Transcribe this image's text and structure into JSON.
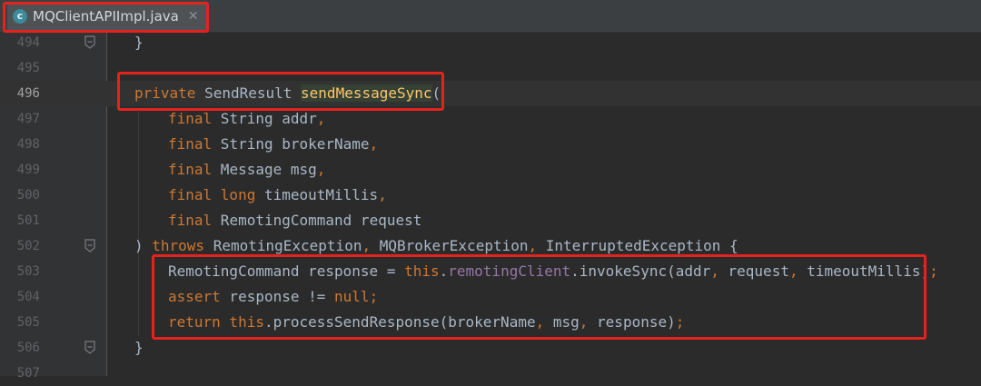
{
  "tab": {
    "icon_letter": "c",
    "label": "MQClientAPIImpl.java",
    "close": "✕",
    "active": true
  },
  "colors": {
    "background": "#2b2b2b",
    "keyword": "#cc7832",
    "method": "#ffc66d",
    "field": "#9876aa",
    "text": "#a9b7c6",
    "annotation_box": "#e3231e"
  },
  "lines": [
    {
      "num": "494",
      "indent": 0,
      "tokens": [
        {
          "t": "}",
          "c": ""
        }
      ],
      "fold": true
    },
    {
      "num": "495",
      "indent": 0,
      "tokens": []
    },
    {
      "num": "496",
      "indent": 0,
      "current": true,
      "tokens": [
        {
          "t": "private",
          "c": "kw"
        },
        {
          "t": " SendResult ",
          "c": ""
        },
        {
          "t": "sendMessageSync",
          "c": "fn"
        },
        {
          "t": "(",
          "c": ""
        }
      ]
    },
    {
      "num": "497",
      "indent": 1,
      "tokens": [
        {
          "t": "final",
          "c": "kw"
        },
        {
          "t": " String addr",
          "c": ""
        },
        {
          "t": ",",
          "c": "kw"
        }
      ]
    },
    {
      "num": "498",
      "indent": 1,
      "tokens": [
        {
          "t": "final",
          "c": "kw"
        },
        {
          "t": " String brokerName",
          "c": ""
        },
        {
          "t": ",",
          "c": "kw"
        }
      ]
    },
    {
      "num": "499",
      "indent": 1,
      "tokens": [
        {
          "t": "final",
          "c": "kw"
        },
        {
          "t": " Message msg",
          "c": ""
        },
        {
          "t": ",",
          "c": "kw"
        }
      ]
    },
    {
      "num": "500",
      "indent": 1,
      "tokens": [
        {
          "t": "final long",
          "c": "kw"
        },
        {
          "t": " timeoutMillis",
          "c": ""
        },
        {
          "t": ",",
          "c": "kw"
        }
      ]
    },
    {
      "num": "501",
      "indent": 1,
      "tokens": [
        {
          "t": "final",
          "c": "kw"
        },
        {
          "t": " RemotingCommand request",
          "c": ""
        }
      ]
    },
    {
      "num": "502",
      "indent": 0,
      "fold": true,
      "tokens": [
        {
          "t": ") ",
          "c": ""
        },
        {
          "t": "throws",
          "c": "kw"
        },
        {
          "t": " RemotingException",
          "c": ""
        },
        {
          "t": ",",
          "c": "kw"
        },
        {
          "t": " MQBrokerException",
          "c": ""
        },
        {
          "t": ",",
          "c": "kw"
        },
        {
          "t": " InterruptedException {",
          "c": ""
        }
      ]
    },
    {
      "num": "503",
      "indent": 1,
      "tokens": [
        {
          "t": "RemotingCommand response = ",
          "c": ""
        },
        {
          "t": "this",
          "c": "kw"
        },
        {
          "t": ".",
          "c": ""
        },
        {
          "t": "remotingClient",
          "c": "fld"
        },
        {
          "t": ".invokeSync(addr",
          "c": ""
        },
        {
          "t": ",",
          "c": "kw"
        },
        {
          "t": " request",
          "c": ""
        },
        {
          "t": ",",
          "c": "kw"
        },
        {
          "t": " timeoutMillis)",
          "c": ""
        },
        {
          "t": ";",
          "c": "kw"
        }
      ]
    },
    {
      "num": "504",
      "indent": 1,
      "tokens": [
        {
          "t": "assert",
          "c": "kw"
        },
        {
          "t": " response != ",
          "c": ""
        },
        {
          "t": "null",
          "c": "kw"
        },
        {
          "t": ";",
          "c": "kw"
        }
      ]
    },
    {
      "num": "505",
      "indent": 1,
      "tokens": [
        {
          "t": "return this",
          "c": "kw"
        },
        {
          "t": ".processSendResponse(brokerName",
          "c": ""
        },
        {
          "t": ",",
          "c": "kw"
        },
        {
          "t": " msg",
          "c": ""
        },
        {
          "t": ",",
          "c": "kw"
        },
        {
          "t": " response)",
          "c": ""
        },
        {
          "t": ";",
          "c": "kw"
        }
      ]
    },
    {
      "num": "506",
      "indent": 0,
      "fold": true,
      "tokens": [
        {
          "t": "}",
          "c": ""
        }
      ]
    },
    {
      "num": "507",
      "indent": 0,
      "tokens": []
    }
  ]
}
